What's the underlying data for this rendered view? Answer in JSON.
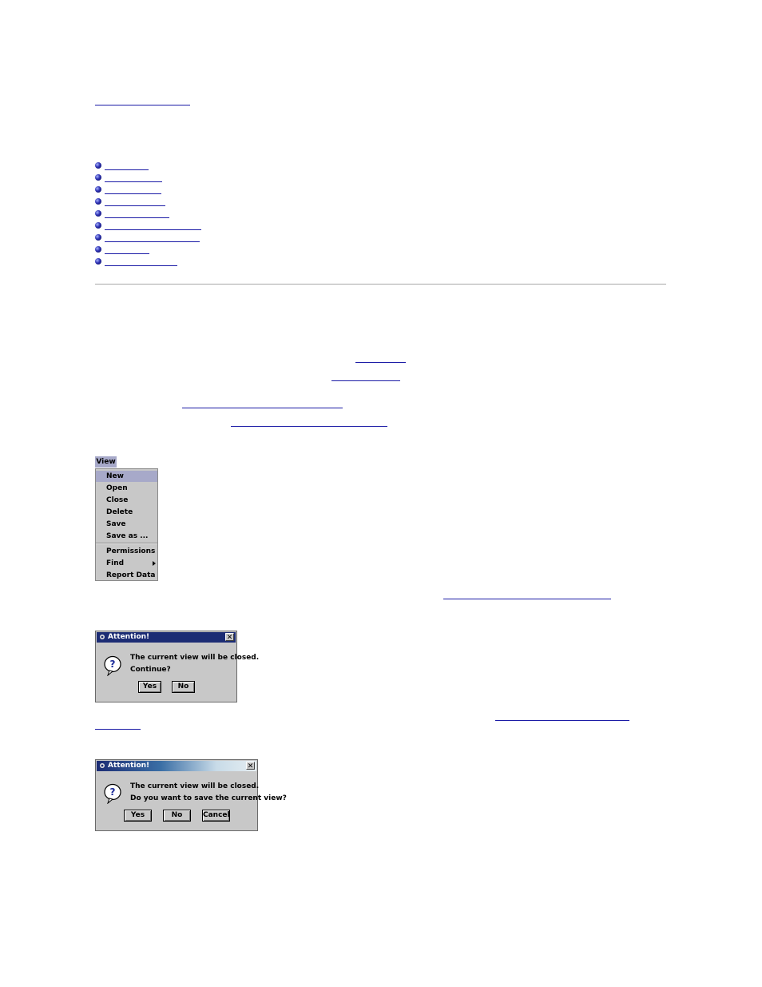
{
  "menu": {
    "title": "View",
    "items": [
      {
        "label": "New",
        "selected": true
      },
      {
        "label": "Open"
      },
      {
        "label": "Close"
      },
      {
        "label": "Delete"
      },
      {
        "label": "Save"
      },
      {
        "label": "Save as ..."
      },
      {
        "label": "Permissions"
      },
      {
        "label": "Find",
        "has_submenu": true
      },
      {
        "label": "Report Data"
      }
    ]
  },
  "dialog1": {
    "title": "Attention!",
    "close_glyph": "✕",
    "line1": "The current view will be closed.",
    "line2": "Continue?",
    "yes_label": "Yes",
    "no_label": "No",
    "titlebar_color": "#1c2c74"
  },
  "dialog2": {
    "title": "Attention!",
    "close_glyph": "✕",
    "line1": "The current view will be closed.",
    "line2": "Do you want to save the current view?",
    "yes_label": "Yes",
    "no_label": "No",
    "cancel_label": "Cancel",
    "titlebar_gradient": [
      "#1c2c74",
      "#3a6ea5",
      "#c8dbe8",
      "#e6eef2"
    ]
  },
  "colors": {
    "link": "#1a1aa6",
    "menu_highlight": "#a7a9c9",
    "panel_bg": "#c8c8c8"
  }
}
